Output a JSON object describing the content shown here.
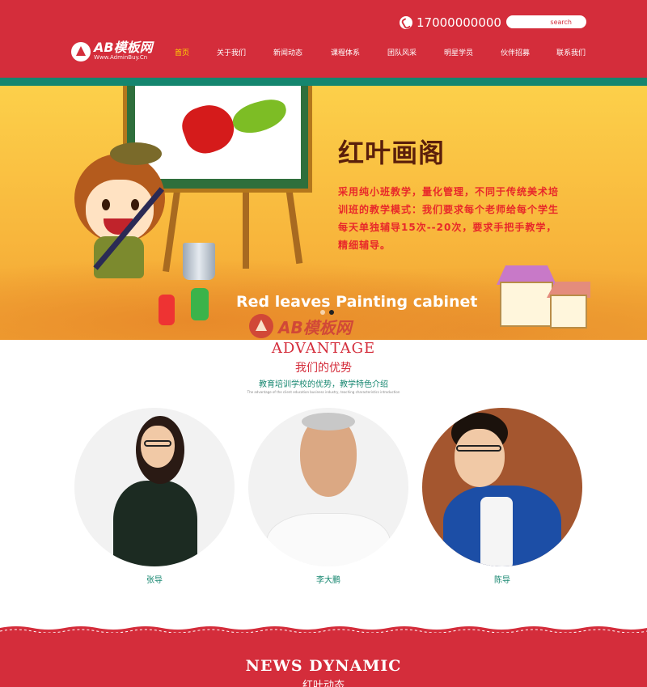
{
  "header": {
    "phone": "17000000000",
    "search_placeholder": "search",
    "logo_title": "AB模板网",
    "logo_sub": "Www.AdminBuy.Cn",
    "nav": [
      "首页",
      "关于我们",
      "新闻动态",
      "课程体系",
      "团队风采",
      "明星学员",
      "伙伴招募",
      "联系我们"
    ],
    "active_nav": "首页"
  },
  "banner": {
    "title": "红叶画阁",
    "description": "采用纯小班教学，量化管理，不同于传统美术培训班的教学模式：我们要求每个老师给每个学生每天单独辅导15次--20次，要求手把手教学，精细辅导。",
    "english": "Red leaves Painting cabinet",
    "slides": 2,
    "active_slide": 2
  },
  "watermark": "AB模板网",
  "advantage": {
    "en_title": "ADVANTAGE",
    "cn_title": "我们的优势",
    "subtitle": "教育培训学校的优势，教学特色介绍",
    "tiny_text": "The advantage of the client education business industry, teaching characteristics introduction"
  },
  "teachers": [
    {
      "name": "张导"
    },
    {
      "name": "李大鹏"
    },
    {
      "name": "陈导"
    }
  ],
  "news": {
    "en_title": "NEWS DYNAMIC",
    "cn_title": "红叶动态"
  },
  "colors": {
    "brand_red": "#d42d3b",
    "accent_green": "#15866f",
    "active_nav": "#ffd700"
  }
}
